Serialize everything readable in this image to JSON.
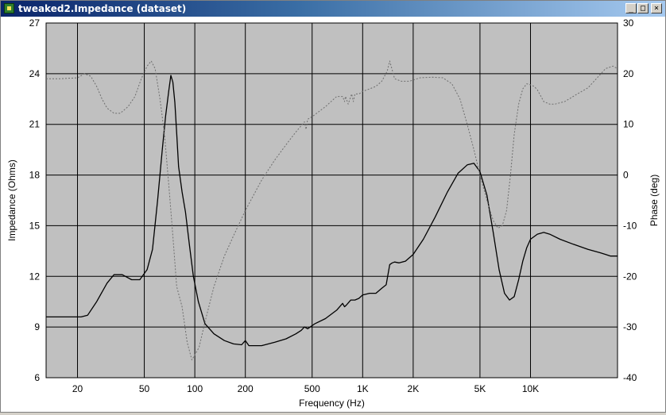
{
  "window": {
    "title": "tweaked2.Impedance (dataset)",
    "controls": {
      "minimize": "_",
      "maximize": "□",
      "close": "×"
    }
  },
  "chart_data": {
    "type": "line",
    "xlabel": "Frequency (Hz)",
    "ylabel": "Impedance (Ohms)",
    "y2label": "Phase (deg)",
    "xscale": "log",
    "xlim": [
      13,
      33000
    ],
    "ylim": [
      6,
      27
    ],
    "y2lim": [
      -40,
      30
    ],
    "grid": true,
    "background": "#c0c0c0",
    "x_ticks": [
      {
        "value": 20,
        "label": "20"
      },
      {
        "value": 50,
        "label": "50"
      },
      {
        "value": 100,
        "label": "100"
      },
      {
        "value": 200,
        "label": "200"
      },
      {
        "value": 500,
        "label": "500"
      },
      {
        "value": 1000,
        "label": "1K"
      },
      {
        "value": 2000,
        "label": "2K"
      },
      {
        "value": 5000,
        "label": "5K"
      },
      {
        "value": 10000,
        "label": "10K"
      }
    ],
    "y_ticks": [
      {
        "value": 6,
        "label": "6"
      },
      {
        "value": 9,
        "label": "9"
      },
      {
        "value": 12,
        "label": "12"
      },
      {
        "value": 15,
        "label": "15"
      },
      {
        "value": 18,
        "label": "18"
      },
      {
        "value": 21,
        "label": "21"
      },
      {
        "value": 24,
        "label": "24"
      },
      {
        "value": 27,
        "label": "27"
      }
    ],
    "y2_ticks": [
      {
        "value": 30,
        "label": "30"
      },
      {
        "value": 20,
        "label": "20"
      },
      {
        "value": 10,
        "label": "10"
      },
      {
        "value": 0,
        "label": "0"
      },
      {
        "value": -10,
        "label": "-10"
      },
      {
        "value": -20,
        "label": "-20"
      },
      {
        "value": -30,
        "label": "-30"
      },
      {
        "value": -40,
        "label": "-40"
      }
    ],
    "series": [
      {
        "axis": "left",
        "color": "#000000",
        "dash": "solid",
        "x": [
          13,
          15,
          18,
          20,
          21,
          23,
          26,
          30,
          33,
          37,
          42,
          47,
          52,
          56,
          60,
          64,
          67,
          70,
          72,
          74,
          76,
          78,
          80,
          84,
          88,
          93,
          98,
          105,
          115,
          130,
          150,
          170,
          190,
          200,
          210,
          250,
          300,
          350,
          400,
          430,
          450,
          470,
          520,
          600,
          700,
          760,
          780,
          800,
          850,
          900,
          950,
          1000,
          1100,
          1200,
          1300,
          1380,
          1450,
          1500,
          1550,
          1650,
          1800,
          2000,
          2300,
          2700,
          3200,
          3700,
          4200,
          4600,
          5000,
          5500,
          6000,
          6500,
          7000,
          7500,
          8000,
          8500,
          9000,
          9500,
          10000,
          11000,
          12000,
          13000,
          15000,
          18000,
          22000,
          26000,
          28000,
          30000,
          32000,
          33000
        ],
        "y": [
          9.6,
          9.6,
          9.6,
          9.6,
          9.6,
          9.7,
          10.5,
          11.6,
          12.1,
          12.1,
          11.8,
          11.8,
          12.4,
          13.6,
          16.5,
          19.5,
          21.5,
          23.0,
          23.9,
          23.5,
          22.3,
          20.5,
          18.5,
          17.0,
          15.8,
          13.8,
          12.0,
          10.5,
          9.2,
          8.6,
          8.2,
          8.0,
          7.95,
          8.2,
          7.9,
          7.9,
          8.1,
          8.3,
          8.6,
          8.8,
          9.0,
          8.9,
          9.2,
          9.5,
          10.0,
          10.4,
          10.2,
          10.3,
          10.6,
          10.6,
          10.7,
          10.9,
          11.0,
          11.0,
          11.3,
          11.5,
          12.7,
          12.8,
          12.85,
          12.8,
          12.9,
          13.3,
          14.2,
          15.5,
          17.0,
          18.1,
          18.6,
          18.7,
          18.2,
          16.8,
          14.6,
          12.4,
          11.0,
          10.6,
          10.8,
          11.8,
          12.9,
          13.7,
          14.2,
          14.5,
          14.6,
          14.5,
          14.2,
          13.9,
          13.6,
          13.4,
          13.3,
          13.2,
          13.2,
          13.2
        ]
      },
      {
        "axis": "right",
        "color": "#6e6e6e",
        "dash": "dotted",
        "x": [
          13,
          16,
          20,
          22,
          24,
          26,
          28,
          30,
          33,
          36,
          40,
          44,
          48,
          52,
          55,
          58,
          62,
          66,
          70,
          74,
          78,
          84,
          90,
          96,
          100,
          106,
          115,
          130,
          150,
          170,
          200,
          250,
          300,
          350,
          400,
          450,
          460,
          470,
          500,
          600,
          700,
          760,
          780,
          790,
          820,
          860,
          880,
          900,
          950,
          1000,
          1100,
          1200,
          1300,
          1400,
          1450,
          1550,
          1700,
          1900,
          2200,
          2600,
          3000,
          3400,
          3800,
          4200,
          4600,
          5000,
          5500,
          6000,
          6400,
          6800,
          7200,
          7600,
          8000,
          8500,
          9000,
          9500,
          10000,
          10500,
          11000,
          12000,
          13000,
          14000,
          16000,
          19000,
          22000,
          25000,
          28000,
          31000,
          33000
        ],
        "y": [
          19,
          19,
          19.2,
          20,
          19.5,
          17.5,
          15,
          13.2,
          12.2,
          12.2,
          13.5,
          15.5,
          19,
          21.5,
          22.5,
          21,
          15,
          8,
          -2,
          -12,
          -22,
          -26,
          -33,
          -36.5,
          -35.5,
          -34,
          -29,
          -22,
          -16,
          -12,
          -7,
          -1,
          3,
          6,
          8.5,
          10.5,
          9,
          11,
          11.5,
          13.5,
          15.5,
          15.5,
          14.5,
          15.5,
          14,
          16,
          14.5,
          16,
          16,
          16.5,
          17,
          17.5,
          18.5,
          20.5,
          22.5,
          19,
          18.5,
          18.5,
          19.2,
          19.3,
          19.2,
          18,
          15,
          10,
          5,
          0,
          -5,
          -9,
          -10.5,
          -10,
          -7,
          0,
          8,
          14,
          17,
          18,
          17.8,
          17.5,
          16.8,
          14.5,
          14,
          14,
          14.5,
          16,
          17.2,
          19.2,
          21,
          21.5,
          21
        ]
      }
    ]
  }
}
